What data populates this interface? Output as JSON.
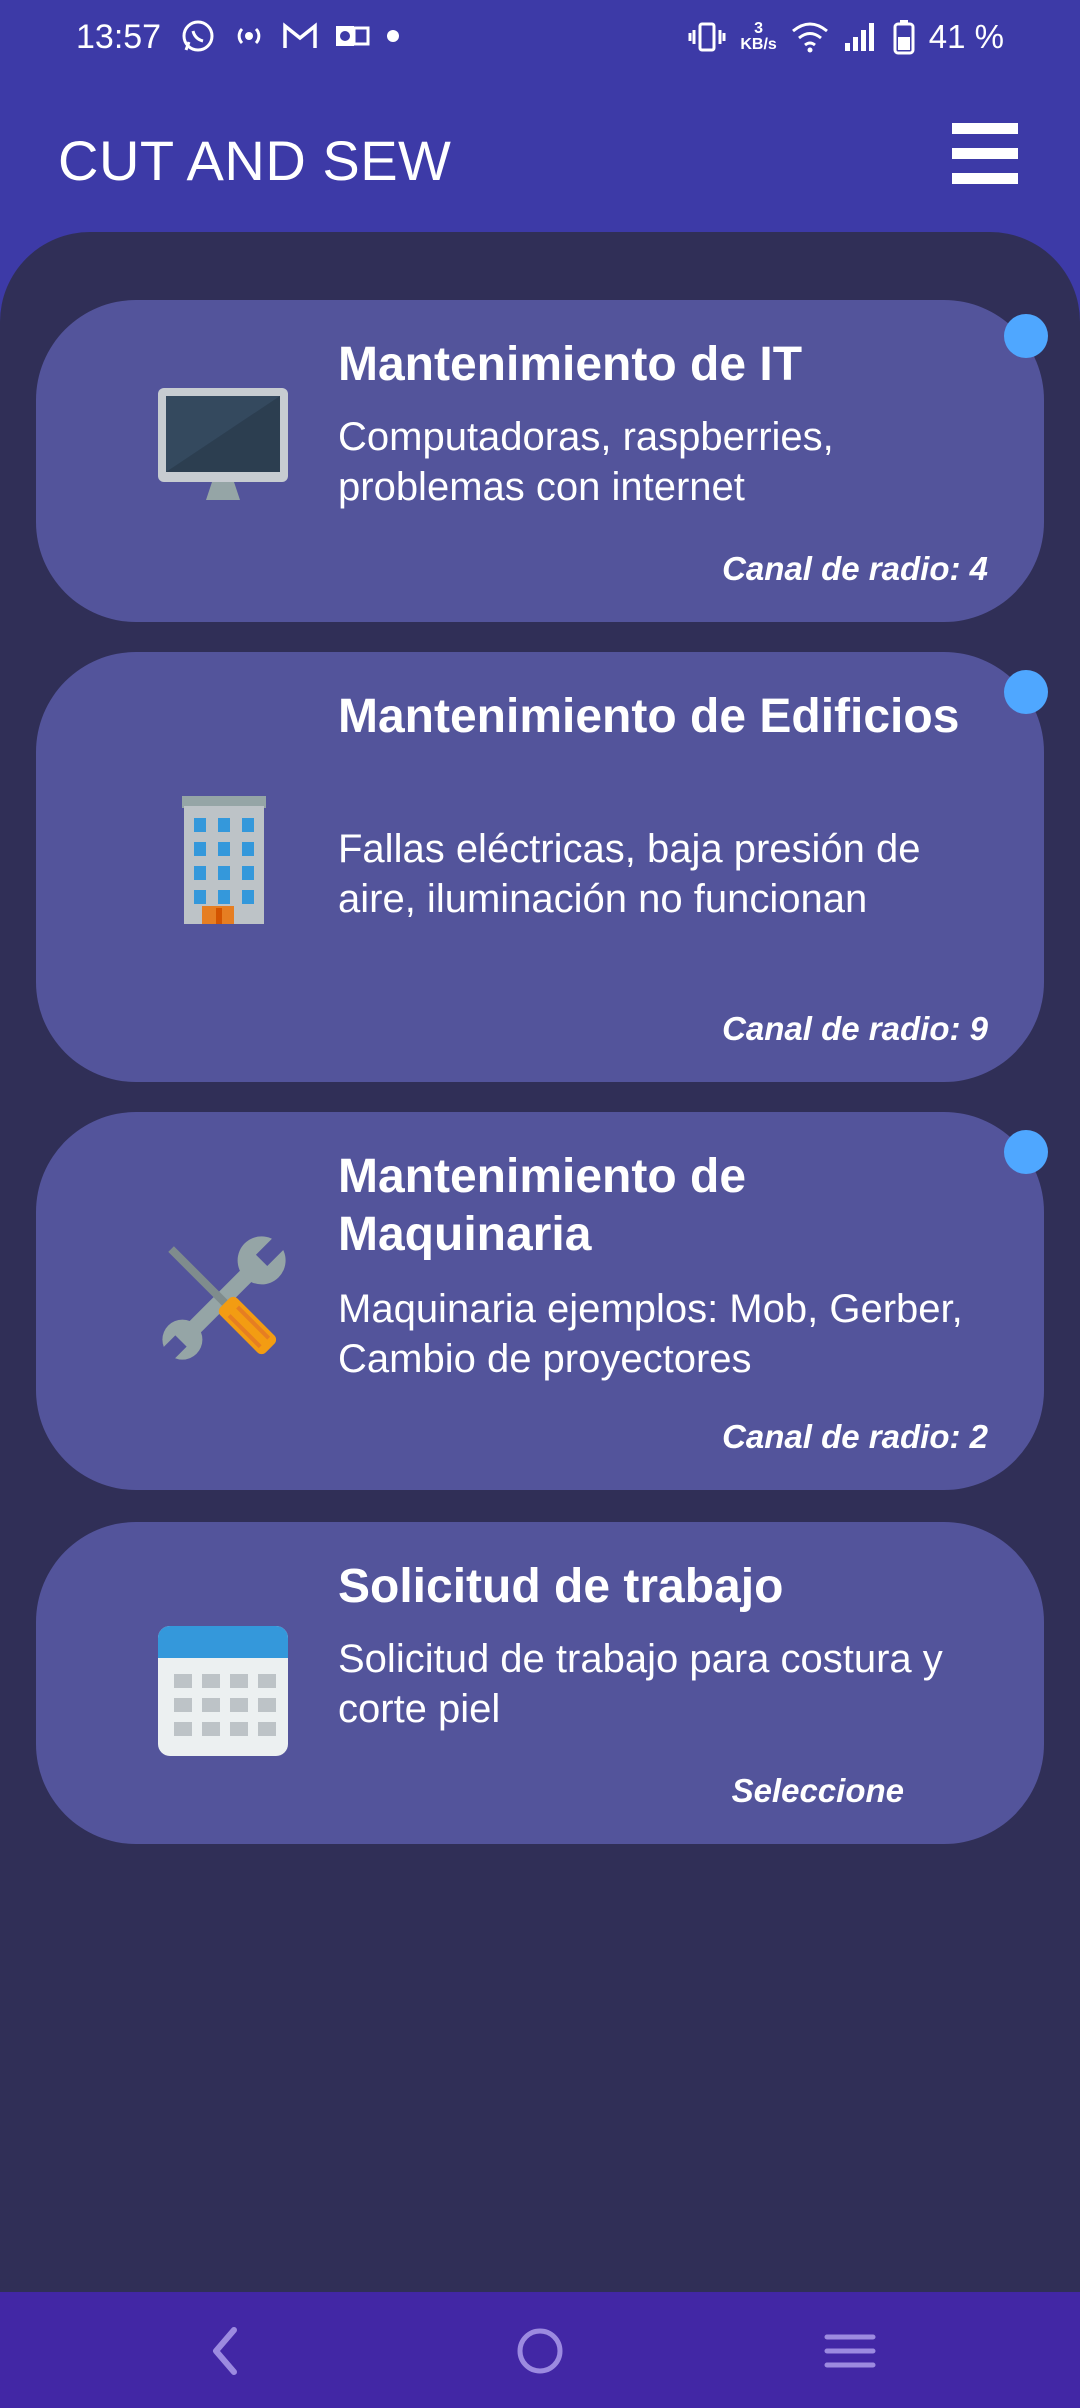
{
  "status_bar": {
    "time": "13:57",
    "battery_text": "41 %",
    "network_speed_top": "3",
    "network_speed_unit": "KB/s",
    "left_icons": [
      "whatsapp-icon",
      "radio-icon",
      "gmail-icon",
      "outlook-icon",
      "dot-icon"
    ],
    "right_icons": [
      "vibrate-icon",
      "speed-icon",
      "wifi-icon",
      "signal-icon",
      "battery-icon"
    ]
  },
  "header": {
    "title": "CUT AND SEW",
    "menu_icon": "hamburger-menu-icon"
  },
  "cards": [
    {
      "title": "Mantenimiento de IT",
      "description": "Computadoras, raspberries, problemas con internet",
      "footer": "Canal de radio: 4",
      "icon": "computer-monitor-icon"
    },
    {
      "title": "Mantenimiento de Edificios",
      "description": "Fallas eléctricas, baja presión de aire, iluminación no funcionan",
      "footer": "Canal de radio: 9",
      "icon": "office-building-icon"
    },
    {
      "title": "Mantenimiento de Maquinaria",
      "description": "Maquinaria ejemplos: Mob, Gerber, Cambio de proyectores",
      "footer": "Canal de radio: 2",
      "icon": "tools-icon"
    },
    {
      "title": "Solicitud de trabajo",
      "description": "Solicitud de trabajo para costura y corte piel",
      "footer": "Seleccione",
      "icon": "calendar-icon"
    }
  ],
  "colors": {
    "header_bg": "#3d3aa7",
    "panel_bg": "#302f57",
    "card_bg": "#53549b",
    "indicator_dot": "#4fa7ff",
    "nav_bg": "#4227a5"
  },
  "nav": {
    "icons": [
      "back-icon",
      "home-icon",
      "recents-icon"
    ]
  }
}
